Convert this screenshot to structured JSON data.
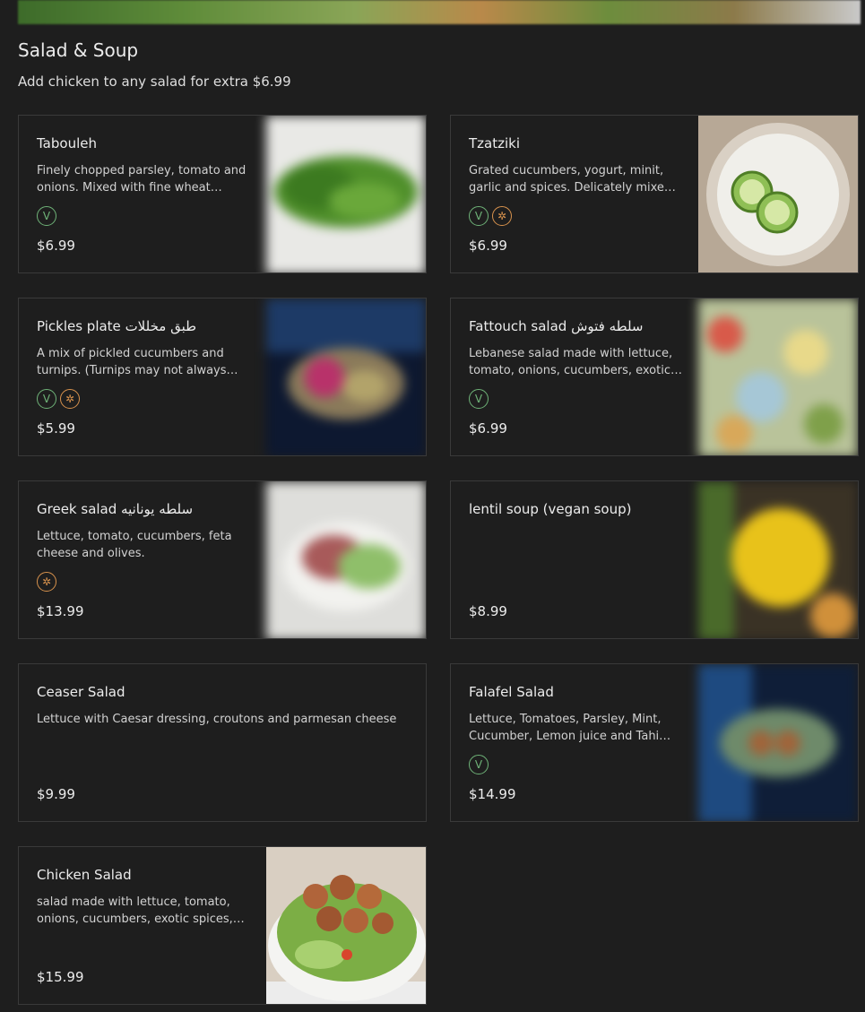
{
  "section": {
    "title": "Salad & Soup",
    "subtitle": "Add chicken to any salad for extra $6.99"
  },
  "items": [
    {
      "name": "Tabouleh",
      "description": "Finely chopped parsley, tomato and onions. Mixed with fine wheat…",
      "badges": [
        "vegan"
      ],
      "price": "$6.99",
      "image": "tabouleh-photo"
    },
    {
      "name": "Tzatziki",
      "description": "Grated cucumbers, yogurt, minit, garlic and spices. Delicately mixe…",
      "badges": [
        "vegan",
        "gluten-free"
      ],
      "price": "$6.99",
      "image": "tzatziki-photo"
    },
    {
      "name": "Pickles plate طبق مخللات",
      "description": "A mix of pickled cucumbers and turnips. (Turnips may not always…",
      "badges": [
        "vegan",
        "gluten-free"
      ],
      "price": "$5.99",
      "image": "pickles-photo"
    },
    {
      "name": "Fattouch salad سلطه فتوش",
      "description": "Lebanese salad made with lettuce, tomato, onions, cucumbers, exotic…",
      "badges": [
        "vegan"
      ],
      "price": "$6.99",
      "image": "fattouch-photo"
    },
    {
      "name": "Greek salad سلطه يونانيه",
      "description": "Lettuce, tomato, cucumbers, feta cheese and olives.",
      "badges": [
        "gluten-free"
      ],
      "price": "$13.99",
      "image": "greek-salad-photo"
    },
    {
      "name": "lentil soup (vegan soup)",
      "description": "",
      "badges": [],
      "price": "$8.99",
      "image": "lentil-soup-photo"
    },
    {
      "name": "Ceaser Salad",
      "description": "Lettuce with Caesar dressing, croutons and parmesan cheese",
      "badges": [],
      "price": "$9.99",
      "image": ""
    },
    {
      "name": "Falafel Salad",
      "description": "Lettuce, Tomatoes, Parsley, Mint, Cucumber, Lemon juice and Tahi…",
      "badges": [
        "vegan"
      ],
      "price": "$14.99",
      "image": "falafel-salad-photo"
    },
    {
      "name": "Chicken Salad",
      "description": "salad made with lettuce, tomato, onions, cucumbers, exotic spices,…",
      "badges": [],
      "price": "$15.99",
      "image": "chicken-salad-photo"
    }
  ],
  "badge_glyphs": {
    "vegan": "V",
    "gluten-free": "✲"
  },
  "colors": {
    "vegan": "#6fb378",
    "gluten-free": "#d8924d",
    "background": "#1e1e1e",
    "card_border": "#3a3a3a"
  }
}
